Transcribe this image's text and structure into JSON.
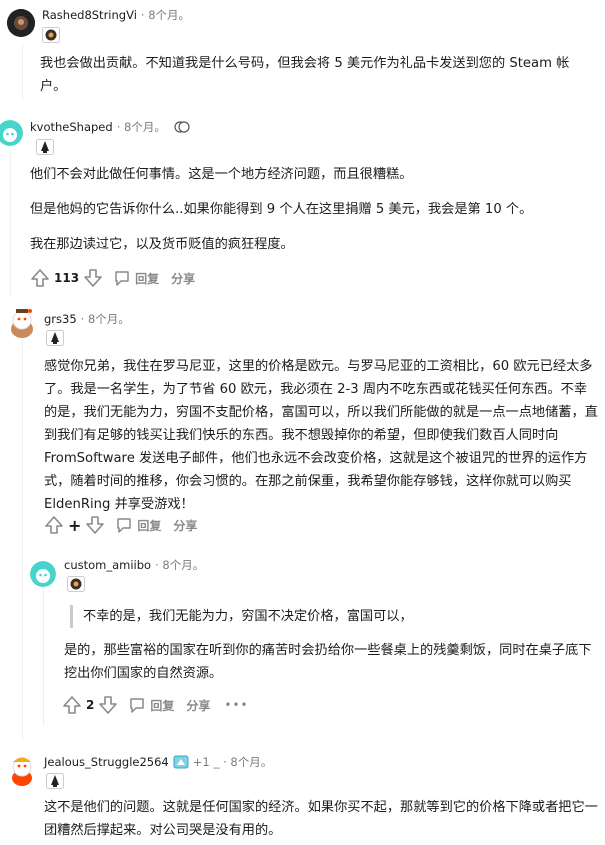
{
  "comments": [
    {
      "username": "Rashed8StringVi",
      "time": "· 8个月。",
      "paragraphs": [
        "我也会做出贡献。不知道我是什么号码，但我会将 5 美元作为礼品卡发送到您的 Steam 帐户。"
      ]
    },
    {
      "username": "kvotheShaped",
      "time": "· 8个月。",
      "paragraphs": [
        "他们不会对此做任何事情。这是一个地方经济问题，而且很糟糕。",
        "但是他妈的它告诉你什么..如果你能得到 9 个人在这里捐赠 5 美元，我会是第 10 个。",
        "我在那边读过它，以及货币贬值的疯狂程度。"
      ],
      "votes": "113",
      "reply": "回复",
      "share": "分享"
    },
    {
      "username": "grs35",
      "time": "· 8个月。",
      "paragraphs": [
        "感觉你兄弟，我住在罗马尼亚，这里的价格是欧元。与罗马尼亚的工资相比，60 欧元已经太多了。我是一名学生，为了节省 60 欧元，我必须在 2-3 周内不吃东西或花钱买任何东西。不幸的是，我们无能为力，穷国不支配价格，富国可以，所以我们所能做的就是一点一点地储蓄，直到我们有足够的钱买让我们快乐的东西。我不想毁掉你的希望，但即使我们数百人同时向 FromSoftware 发送电子邮件，他们也永远不会改变价格，这就是这个被诅咒的世界的运作方式，随着时间的推移，你会习惯的。在那之前保重，我希望你能存够钱，这样你就可以购买 EldenRing 并享受游戏！"
      ],
      "votes": "+",
      "reply": "回复",
      "share": "分享"
    },
    {
      "username": "custom_amiibo",
      "time": "· 8个月。",
      "quote": "不幸的是，我们无能为力，穷国不决定价格，富国可以，",
      "paragraphs": [
        "是的，那些富裕的国家在听到你的痛苦时会扔给你一些餐桌上的残羹剩饭，同时在桌子底下挖出你们国家的自然资源。"
      ],
      "votes": "2",
      "reply": "回复",
      "share": "分享"
    },
    {
      "username": "Jealous_Struggle2564",
      "award_count": "+1",
      "time": "_ · 8个月。",
      "paragraphs": [
        "这不是他们的问题。这就是任何国家的经济。如果你买不起，那就等到它的价格下降或者把它一团糟然后撑起来。对公司哭是没有用的。"
      ]
    }
  ],
  "more_icon": "•••",
  "colors": {
    "text": "#1c1c1c",
    "meta": "#7c7c7c",
    "action": "#878a8c",
    "thread_line": "#edeff1",
    "quote_bar": "#c9ccce"
  }
}
